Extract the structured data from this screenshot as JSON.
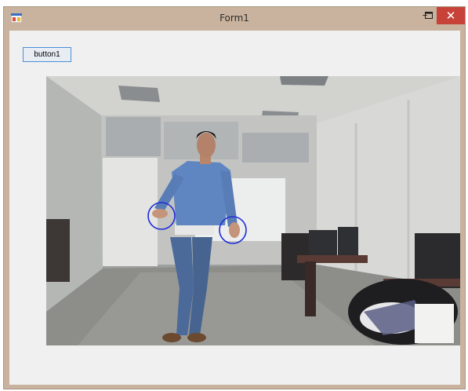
{
  "window": {
    "title": "Form1",
    "controls": {
      "minimize": "–",
      "maximize": "☐",
      "close": "✕"
    }
  },
  "form": {
    "button1_label": "button1"
  },
  "picturebox": {
    "content": "camera-frame-person-standing",
    "markers": [
      "left-hand-circle-marker",
      "right-hand-circle-marker"
    ]
  },
  "colors": {
    "titlebar": "#c9b39e",
    "close_button": "#c7433a",
    "client_bg": "#f0f0f0",
    "button_border": "#4b8fd9",
    "marker": "#1f2bd8"
  }
}
